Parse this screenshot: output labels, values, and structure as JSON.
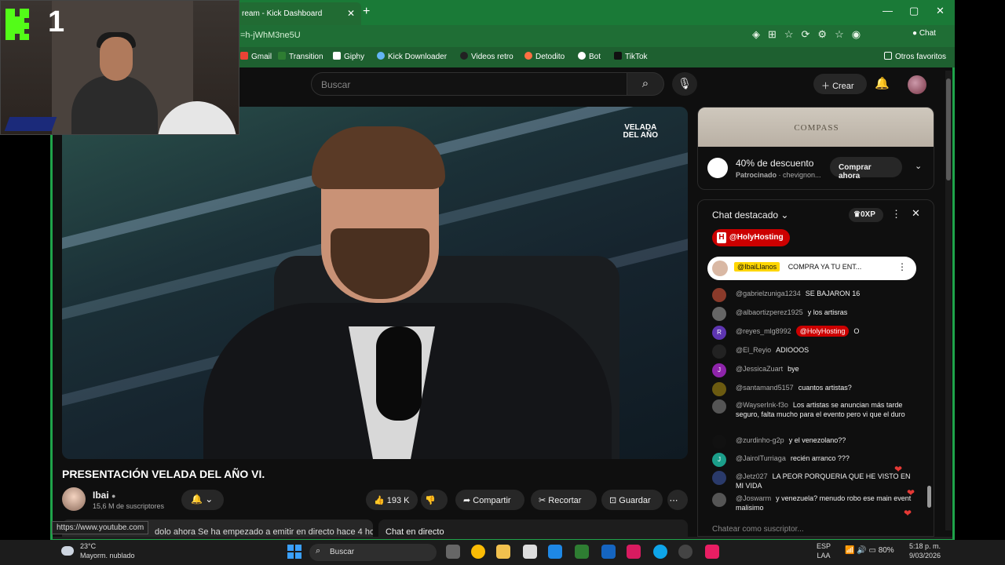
{
  "browser": {
    "tab_title": "ream - Kick Dashboard",
    "url": "=h-jWhM3ne5U",
    "chat_button": "Chat",
    "bookmarks": [
      "Gmail",
      "Transition",
      "Giphy",
      "Kick  Downloader",
      "Videos retro",
      "Detodito",
      "Bot",
      "TikTok"
    ],
    "other_favorites": "Otros favoritos",
    "status_url": "https://www.youtube.com"
  },
  "overlay": {
    "kick_number": "1"
  },
  "youtube": {
    "search_placeholder": "Buscar",
    "create_label": "Crear",
    "video_logo": "VELADA\nDEL AÑO",
    "video_title": "PRESENTACIÓN VELADA DEL AÑO VI.",
    "channel_name": "Ibai",
    "channel_subs": "15,6 M de suscriptores",
    "likes": "193 K",
    "share": "Compartir",
    "clip": "Recortar",
    "save": "Guardar",
    "description": "dolo ahora  Se ha empezado a emitir en directo hace 4 ho",
    "live_chat_label": "Chat en directo"
  },
  "ad": {
    "banner": "COMPASS",
    "title": "40% de descuento",
    "sponsor_prefix": "Patrocinado",
    "sponsor": "chevignon...",
    "cta": "Comprar ahora"
  },
  "chat": {
    "header": "Chat destacado",
    "xp": "0XP",
    "promo_tag": "@HolyHosting",
    "pinned_user": "@IbaiLlanos",
    "pinned_text": "COMPRA YA TU ENT...",
    "input_placeholder": "Chatear como suscriptor...",
    "messages": [
      {
        "user": "@gabrielzuniga1234",
        "text": "SE BAJARON 16",
        "color": "#8a3a2a",
        "initial": ""
      },
      {
        "user": "@albaortizperez1925",
        "text": "y los artisras",
        "color": "#666",
        "initial": ""
      },
      {
        "user": "@reyes_mlg8992",
        "mention": "@HolyHosting",
        "text": "O",
        "color": "#5e35b1",
        "initial": "R"
      },
      {
        "user": "@El_Reyio",
        "text": "ADIOOOS",
        "color": "#222",
        "initial": ""
      },
      {
        "user": "@JessicaZuart",
        "text": "bye",
        "color": "#8e24aa",
        "initial": "J"
      },
      {
        "user": "@santamand5157",
        "text": "cuantos artistas?",
        "color": "#6b5a10",
        "initial": ""
      },
      {
        "user": "@WayserInk-f3o",
        "text": "Los artistas se anuncian más tarde seguro, falta mucho para el evento pero vi que el duro",
        "color": "#555",
        "initial": ""
      },
      {
        "user": "@zurdinho-g2p",
        "text": "y el venezolano??",
        "color": "#111",
        "initial": ""
      },
      {
        "user": "@JairolTurriaga",
        "text": "recién arranco ???",
        "color": "#1b9e8a",
        "initial": "J"
      },
      {
        "user": "@Jetz027",
        "text": "LA PEOR PORQUERIA QUE HE VISTO EN MI VIDA",
        "color": "#2a3a6a",
        "initial": ""
      },
      {
        "user": "@Joswarm",
        "text": "y venezuela? menudo robo ese main event malisimo",
        "color": "#555",
        "initial": ""
      }
    ]
  },
  "taskbar": {
    "temperature": "23°C",
    "weather": "Mayorm. nublado",
    "search": "Buscar",
    "lang": "ESP",
    "region": "LAA",
    "battery": "80%",
    "time": "5:18 p. m.",
    "date": "9/03/2026"
  }
}
